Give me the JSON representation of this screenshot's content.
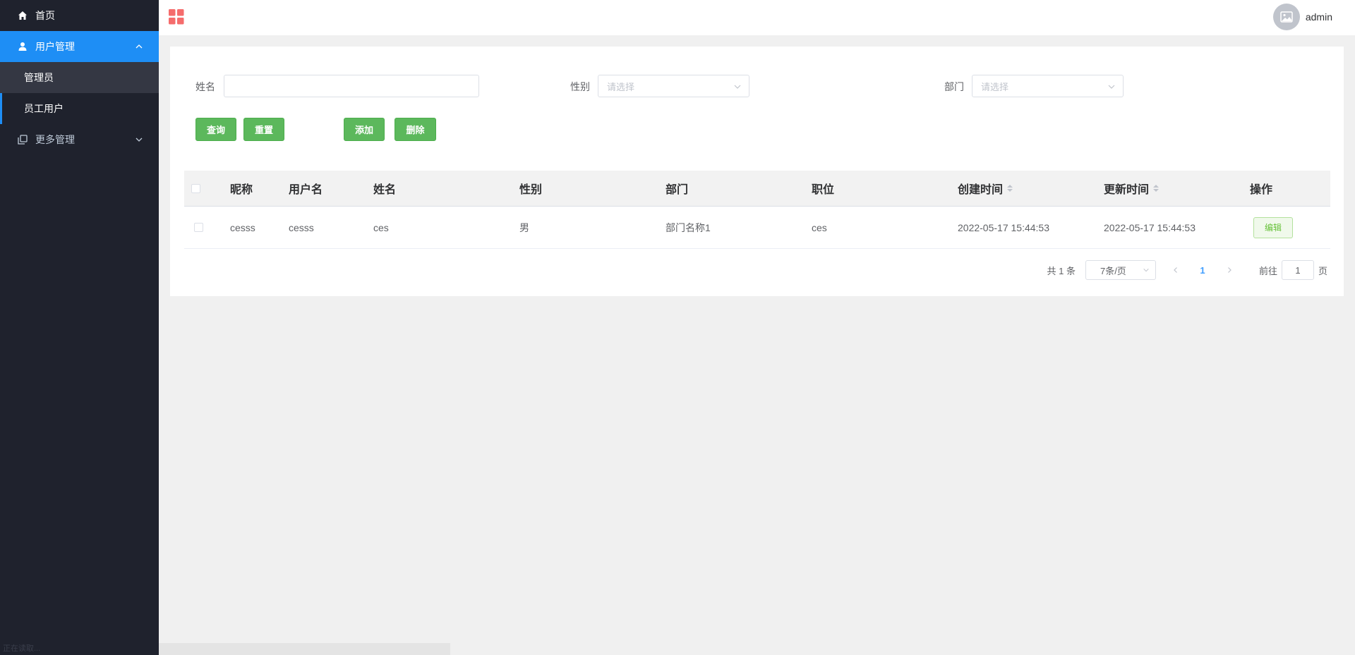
{
  "sidebar": {
    "items": [
      {
        "label": "首页",
        "icon": "home-icon"
      },
      {
        "label": "用户管理",
        "icon": "user-icon",
        "expanded": true,
        "children": [
          {
            "label": "管理员"
          },
          {
            "label": "员工用户"
          }
        ]
      },
      {
        "label": "更多管理",
        "icon": "copy-icon",
        "expanded": false
      }
    ],
    "status_text": "正在读取..."
  },
  "header": {
    "username": "admin"
  },
  "filters": {
    "name_label": "姓名",
    "name_value": "",
    "gender_label": "性别",
    "gender_placeholder": "请选择",
    "dept_label": "部门",
    "dept_placeholder": "请选择"
  },
  "buttons": {
    "query": "查询",
    "reset": "重置",
    "add": "添加",
    "delete": "删除"
  },
  "table": {
    "columns": [
      "昵称",
      "用户名",
      "姓名",
      "性别",
      "部门",
      "职位",
      "创建时间",
      "更新时间",
      "操作"
    ],
    "rows": [
      {
        "nickname": "cesss",
        "username": "cesss",
        "name": "ces",
        "gender": "男",
        "dept": "部门名称1",
        "position": "ces",
        "created": "2022-05-17 15:44:53",
        "updated": "2022-05-17 15:44:53",
        "action": "编辑"
      }
    ]
  },
  "pagination": {
    "total": "共 1 条",
    "page_size": "7条/页",
    "current_page": "1",
    "goto_label": "前往",
    "goto_value": "1",
    "page_suffix": "页"
  },
  "colors": {
    "sidebar_bg": "#1f222d",
    "accent": "#1e8ef5",
    "button_green": "#5cb85c",
    "grid_icon": "#f56c6c"
  }
}
